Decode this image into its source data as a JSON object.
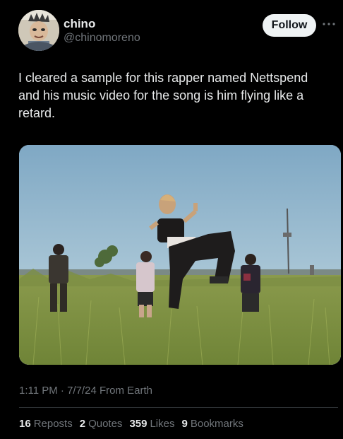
{
  "author": {
    "display_name": "chino",
    "handle": "@chinomoreno",
    "avatar_icon": "avatar-photo"
  },
  "actions": {
    "follow_label": "Follow",
    "more_icon": "more-horizontal-icon"
  },
  "tweet": {
    "text": "I cleared a sample for this rapper named Nettspend and his music video for the song is him flying like a retard."
  },
  "media": {
    "kind": "video-still",
    "subject": "person leaping mid-air over tall grass field with three people behind"
  },
  "meta": {
    "timestamp": "1:11 PM · 7/7/24 From Earth"
  },
  "stats": [
    {
      "count": "16",
      "label": "Reposts"
    },
    {
      "count": "2",
      "label": "Quotes"
    },
    {
      "count": "359",
      "label": "Likes"
    },
    {
      "count": "9",
      "label": "Bookmarks"
    }
  ],
  "colors": {
    "background": "#000000",
    "primary_text": "#e7e9ea",
    "secondary_text": "#71767b",
    "divider": "#2f3336",
    "follow_bg": "#eff3f4"
  }
}
